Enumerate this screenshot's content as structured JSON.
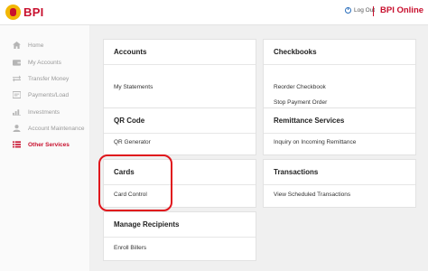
{
  "header": {
    "logo_text": "BPI",
    "logout_label": "Log Out",
    "brand_label": "BPI Online"
  },
  "sidebar": {
    "items": [
      {
        "label": "Home",
        "icon": "home-icon"
      },
      {
        "label": "My Accounts",
        "icon": "wallet-icon"
      },
      {
        "label": "Transfer Money",
        "icon": "transfer-icon"
      },
      {
        "label": "Payments/Load",
        "icon": "bill-icon"
      },
      {
        "label": "Investments",
        "icon": "chart-icon"
      },
      {
        "label": "Account Maintenance",
        "icon": "person-icon"
      },
      {
        "label": "Other Services",
        "icon": "list-icon",
        "active": true
      }
    ]
  },
  "cards": {
    "accounts": {
      "title": "Accounts",
      "links": [
        "My Statements"
      ]
    },
    "checkbooks": {
      "title": "Checkbooks",
      "links": [
        "Reorder Checkbook",
        "Stop Payment Order"
      ]
    },
    "qr_code": {
      "title": "QR Code",
      "links": [
        "QR Generator"
      ]
    },
    "remittance": {
      "title": "Remittance Services",
      "links": [
        "Inquiry on Incoming Remittance"
      ]
    },
    "cards": {
      "title": "Cards",
      "links": [
        "Card Control"
      ]
    },
    "transactions": {
      "title": "Transactions",
      "links": [
        "View Scheduled Transactions"
      ]
    },
    "recipients": {
      "title": "Manage Recipients",
      "links": [
        "Enroll Billers"
      ]
    }
  },
  "colors": {
    "brand_red": "#c8102e",
    "brand_yellow": "#f2b705",
    "highlight": "#e0151c"
  }
}
